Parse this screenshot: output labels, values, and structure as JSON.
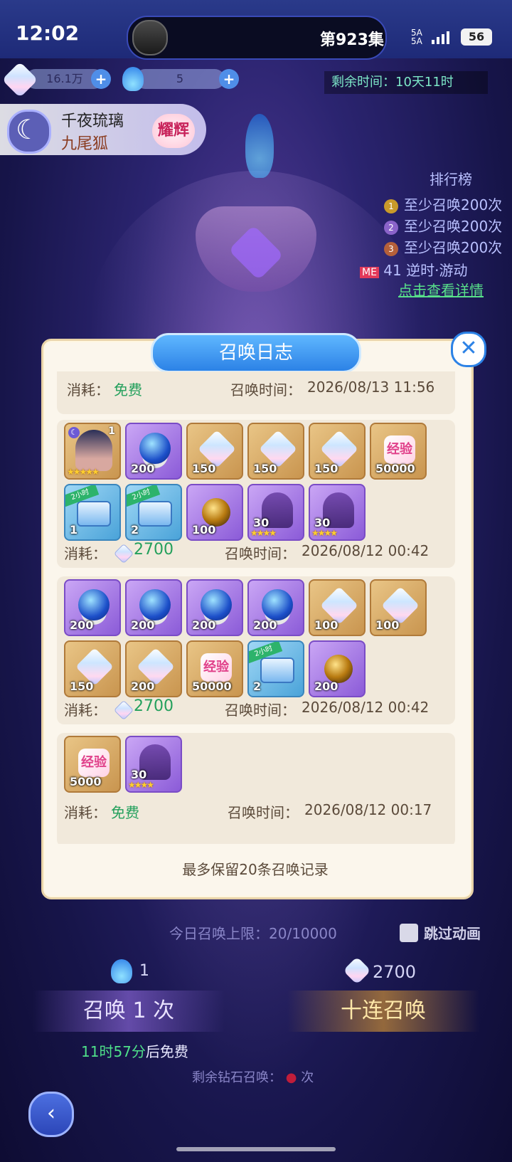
{
  "status_bar": {
    "time": "12:02",
    "episode": "第923集",
    "signal": "5A\n5A",
    "battery": "56"
  },
  "currency": {
    "gems": "16.1万",
    "tickets": "5",
    "plus": "+"
  },
  "event_timer": "剩余时间：10天11时",
  "character": {
    "name": "千夜琉璃",
    "type": "九尾狐",
    "badge": "耀辉"
  },
  "ranking": {
    "title": "排行榜",
    "rows": [
      "至少召唤200次",
      "至少召唤200次",
      "至少召唤200次"
    ],
    "me_label": "ME",
    "me_text": "41",
    "me_name": "逆时·游动",
    "detail_link": "点击查看详情"
  },
  "dialog": {
    "title": "召唤日志",
    "close": "✕",
    "footnote": "最多保留20条召唤记录",
    "cost_label": "消耗：",
    "time_label": "召唤时间：",
    "records": [
      {
        "cost": "免费",
        "time": "2026/08/13 11:56"
      },
      {
        "cost": "2700",
        "time": "2026/08/12 00:42",
        "items": [
          "1",
          "200",
          "150",
          "150",
          "150",
          "50000",
          "1",
          "2",
          "100",
          "30",
          "30"
        ]
      },
      {
        "cost": "2700",
        "time": "2026/08/12 00:42",
        "items": [
          "200",
          "200",
          "200",
          "200",
          "100",
          "100",
          "150",
          "200",
          "50000",
          "2",
          "200"
        ]
      },
      {
        "cost": "免费",
        "time": "2026/08/12 00:17",
        "items": [
          "5000",
          "30"
        ]
      }
    ]
  },
  "summon": {
    "limit_label": "今日召唤上限：",
    "limit_value": "20/10000",
    "skip_animation": "跳过动画",
    "single_cost": "1",
    "ten_cost": "2700",
    "single_btn": "召唤 1 次",
    "ten_btn": "十连召唤",
    "free_time_hours": "11时57分",
    "free_time_suffix": "后免费",
    "remain_label": "剩余钻石召唤：",
    "remain_suffix": "次"
  },
  "icons": {
    "close": "close-icon",
    "back": "back-icon",
    "gem": "gem-icon",
    "flame": "flame-icon",
    "plus": "plus-icon"
  }
}
